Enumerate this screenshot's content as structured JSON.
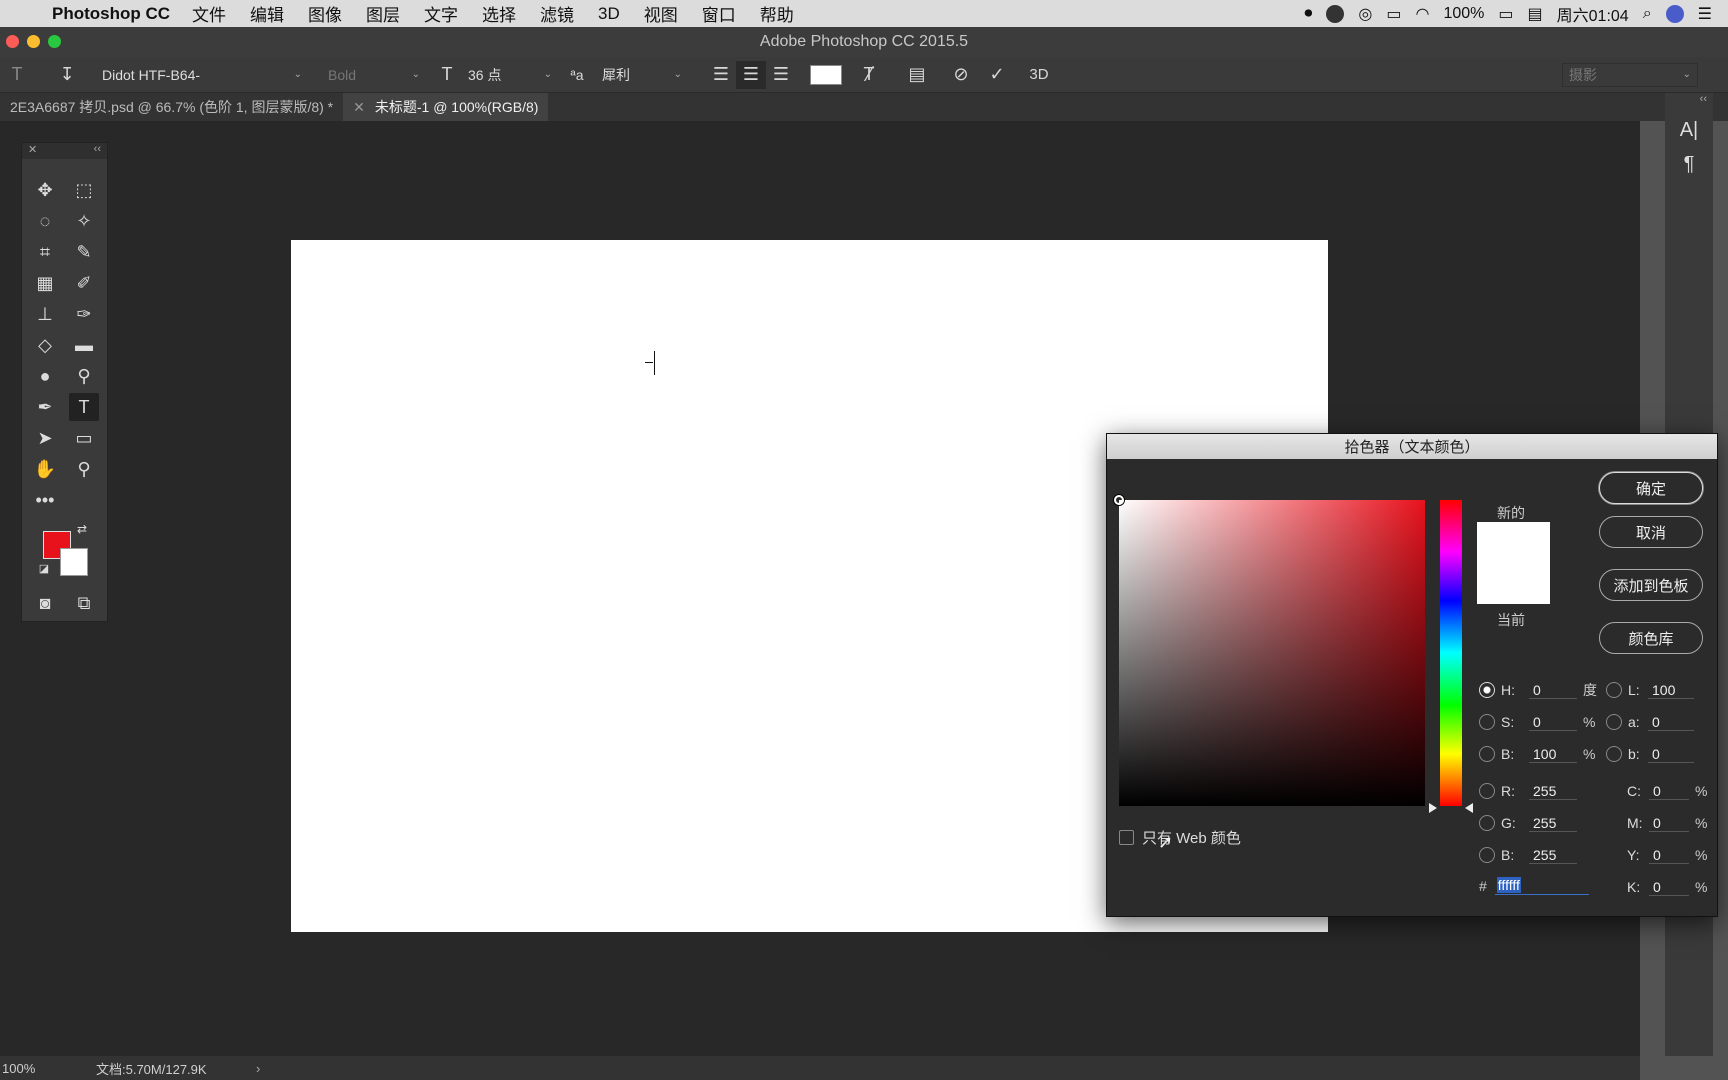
{
  "menubar": {
    "app_name": "Photoshop CC",
    "items": [
      "文件",
      "编辑",
      "图像",
      "图层",
      "文字",
      "选择",
      "滤镜",
      "3D",
      "视图",
      "窗口",
      "帮助"
    ],
    "battery": "100%",
    "clock": "周六01:04"
  },
  "window": {
    "title": "Adobe Photoshop CC 2015.5"
  },
  "options_bar": {
    "font_family": "Didot HTF-B64-",
    "font_style": "Bold",
    "font_size": "36 点",
    "aa_label": "ªa",
    "anti_alias": "犀利",
    "workspace": "摄影"
  },
  "tabs": [
    {
      "label": "2E3A6687 拷贝.psd @ 66.7% (色阶 1, 图层蒙版/8) *"
    },
    {
      "label": "未标题-1 @ 100%(RGB/8)"
    }
  ],
  "colors": {
    "foreground": "#e8121d",
    "background": "#ffffff"
  },
  "statusbar": {
    "zoom": "100%",
    "doc": "文档:5.70M/127.9K"
  },
  "color_picker": {
    "title": "拾色器（文本颜色）",
    "label_new": "新的",
    "label_current": "当前",
    "buttons": {
      "ok": "确定",
      "cancel": "取消",
      "add_swatch": "添加到色板",
      "libraries": "颜色库"
    },
    "web_only": "只有 Web 颜色",
    "hsb": {
      "h": "0",
      "s": "0",
      "b": "100",
      "h_unit": "度",
      "pct": "%"
    },
    "lab": {
      "l": "100",
      "a": "0",
      "b": "0"
    },
    "rgb": {
      "r": "255",
      "g": "255",
      "b": "255"
    },
    "cmyk": {
      "c": "0",
      "m": "0",
      "y": "0",
      "k": "0"
    },
    "labels": {
      "H": "H:",
      "S": "S:",
      "Bh": "B:",
      "L": "L:",
      "a": "a:",
      "bl": "b:",
      "R": "R:",
      "G": "G:",
      "Br": "B:",
      "C": "C:",
      "M": "M:",
      "Y": "Y:",
      "K": "K:"
    },
    "hex_sign": "#",
    "hex": "ffffff"
  }
}
